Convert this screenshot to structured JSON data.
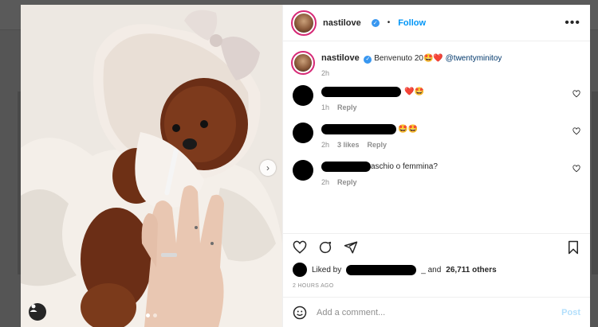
{
  "post": {
    "username": "nastilove",
    "follow_label": "Follow",
    "dot": "•",
    "more_label": "•••",
    "caption": "Benvenuto 20🤩❤️",
    "caption_mention": "@twentyminitoy",
    "caption_time": "2h"
  },
  "comments": [
    {
      "text": "",
      "emojis": "❤️🤩",
      "time": "1h",
      "likes": "",
      "reply_label": "Reply"
    },
    {
      "text": "",
      "emojis": "🤩🤩",
      "time": "2h",
      "likes": "3 likes",
      "reply_label": "Reply"
    },
    {
      "text": "aschio o femmina?",
      "emojis": "",
      "time": "2h",
      "likes": "",
      "reply_label": "Reply"
    }
  ],
  "likes": {
    "liked_by": "Liked by",
    "suffix": "_ and",
    "count": "26,711 others"
  },
  "posted_time": "2 HOURS AGO",
  "composer": {
    "placeholder": "Add a comment...",
    "post_label": "Post"
  },
  "icons": {
    "verified": "verified-badge-icon",
    "heart": "heart-icon",
    "comment": "comment-icon",
    "share": "share-icon",
    "save": "bookmark-icon",
    "emoji": "emoji-icon",
    "next": "chevron-right-icon",
    "tag": "user-tag-icon"
  },
  "colors": {
    "follow": "#0095f6",
    "post_disabled": "#b2dffc",
    "ring": "#d62976"
  }
}
